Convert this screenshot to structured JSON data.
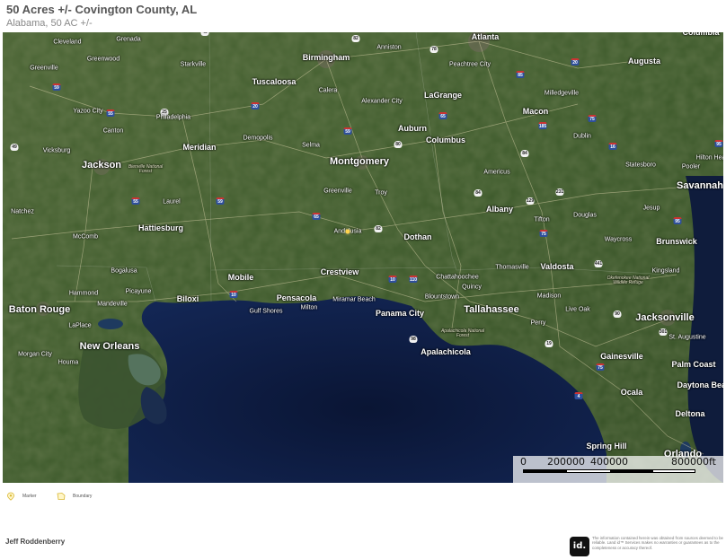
{
  "header": {
    "title": "50 Acres +/- Covington County, AL",
    "subtitle": "Alabama, 50 AC +/-"
  },
  "map": {
    "basemap": "satellite",
    "property_marker_city": "Andalusia",
    "cities": [
      {
        "name": "Cleveland",
        "size": "sm"
      },
      {
        "name": "Grenada",
        "size": "sm"
      },
      {
        "name": "Greenwood",
        "size": "sm"
      },
      {
        "name": "Greenville",
        "size": "sm"
      },
      {
        "name": "Starkville",
        "size": "sm"
      },
      {
        "name": "Birmingham",
        "size": "med"
      },
      {
        "name": "Anniston",
        "size": "sm"
      },
      {
        "name": "Atlanta",
        "size": "med"
      },
      {
        "name": "Peachtree City",
        "size": "sm"
      },
      {
        "name": "Augusta",
        "size": "med"
      },
      {
        "name": "Columbia",
        "size": "med"
      },
      {
        "name": "Tuscaloosa",
        "size": "med"
      },
      {
        "name": "Calera",
        "size": "sm"
      },
      {
        "name": "Alexander City",
        "size": "sm"
      },
      {
        "name": "LaGrange",
        "size": "med"
      },
      {
        "name": "Milledgeville",
        "size": "sm"
      },
      {
        "name": "Yazoo City",
        "size": "sm"
      },
      {
        "name": "Philadelphia",
        "size": "sm"
      },
      {
        "name": "Canton",
        "size": "sm"
      },
      {
        "name": "Demopolis",
        "size": "sm"
      },
      {
        "name": "Auburn",
        "size": "med"
      },
      {
        "name": "Macon",
        "size": "med"
      },
      {
        "name": "Dublin",
        "size": "sm"
      },
      {
        "name": "Vicksburg",
        "size": "sm"
      },
      {
        "name": "Meridian",
        "size": "med"
      },
      {
        "name": "Selma",
        "size": "sm"
      },
      {
        "name": "Columbus",
        "size": "med"
      },
      {
        "name": "Jackson",
        "size": "big"
      },
      {
        "name": "Montgomery",
        "size": "big"
      },
      {
        "name": "Americus",
        "size": "sm"
      },
      {
        "name": "Statesboro",
        "size": "sm"
      },
      {
        "name": "Pooler",
        "size": "sm"
      },
      {
        "name": "Hilton Head",
        "size": "sm"
      },
      {
        "name": "Greenville",
        "size": "sm"
      },
      {
        "name": "Troy",
        "size": "sm"
      },
      {
        "name": "Savannah",
        "size": "big"
      },
      {
        "name": "Natchez",
        "size": "sm"
      },
      {
        "name": "Laurel",
        "size": "sm"
      },
      {
        "name": "Albany",
        "size": "med"
      },
      {
        "name": "Jesup",
        "size": "sm"
      },
      {
        "name": "Tifton",
        "size": "sm"
      },
      {
        "name": "Douglas",
        "size": "sm"
      },
      {
        "name": "McComb",
        "size": "sm"
      },
      {
        "name": "Hattiesburg",
        "size": "med"
      },
      {
        "name": "Andalusia",
        "size": "sm"
      },
      {
        "name": "Dothan",
        "size": "med"
      },
      {
        "name": "Waycross",
        "size": "sm"
      },
      {
        "name": "Brunswick",
        "size": "med"
      },
      {
        "name": "Bogalusa",
        "size": "sm"
      },
      {
        "name": "Mobile",
        "size": "med"
      },
      {
        "name": "Crestview",
        "size": "med"
      },
      {
        "name": "Thomasville",
        "size": "sm"
      },
      {
        "name": "Valdosta",
        "size": "med"
      },
      {
        "name": "Kingsland",
        "size": "sm"
      },
      {
        "name": "Picayune",
        "size": "sm"
      },
      {
        "name": "Milton",
        "size": "sm"
      },
      {
        "name": "Chattahoochee",
        "size": "sm"
      },
      {
        "name": "Quincy",
        "size": "sm"
      },
      {
        "name": "Hammond",
        "size": "sm"
      },
      {
        "name": "Biloxi",
        "size": "med"
      },
      {
        "name": "Pensacola",
        "size": "med"
      },
      {
        "name": "Miramar Beach",
        "size": "sm"
      },
      {
        "name": "Blountstown",
        "size": "sm"
      },
      {
        "name": "Madison",
        "size": "sm"
      },
      {
        "name": "Mandeville",
        "size": "sm"
      },
      {
        "name": "Gulf Shores",
        "size": "sm"
      },
      {
        "name": "Panama City",
        "size": "med"
      },
      {
        "name": "Tallahassee",
        "size": "big"
      },
      {
        "name": "Live Oak",
        "size": "sm"
      },
      {
        "name": "Baton Rouge",
        "size": "big"
      },
      {
        "name": "Jacksonville",
        "size": "big"
      },
      {
        "name": "LaPlace",
        "size": "sm"
      },
      {
        "name": "Perry",
        "size": "sm"
      },
      {
        "name": "St. Augustine",
        "size": "sm"
      },
      {
        "name": "New Orleans",
        "size": "big"
      },
      {
        "name": "Apalachicola",
        "size": "med"
      },
      {
        "name": "Morgan City",
        "size": "sm"
      },
      {
        "name": "Houma",
        "size": "sm"
      },
      {
        "name": "Gainesville",
        "size": "med"
      },
      {
        "name": "Palm Coast",
        "size": "med"
      },
      {
        "name": "Daytona Beach",
        "size": "med"
      },
      {
        "name": "Ocala",
        "size": "med"
      },
      {
        "name": "Deltona",
        "size": "med"
      },
      {
        "name": "Spring Hill",
        "size": "med"
      },
      {
        "name": "Orlando",
        "size": "big"
      }
    ],
    "parks": [
      {
        "name": "Bienville National Forest"
      },
      {
        "name": "Apalachicola National Forest"
      },
      {
        "name": "Okefenokee National Wildlife Refuge"
      }
    ],
    "shields": [
      {
        "label": "45",
        "type": "us"
      },
      {
        "label": "82",
        "type": "us"
      },
      {
        "label": "78",
        "type": "us"
      },
      {
        "label": "59",
        "type": "i"
      },
      {
        "label": "20",
        "type": "i"
      },
      {
        "label": "85",
        "type": "i"
      },
      {
        "label": "25",
        "type": "us"
      },
      {
        "label": "20",
        "type": "i"
      },
      {
        "label": "55",
        "type": "i"
      },
      {
        "label": "59",
        "type": "i"
      },
      {
        "label": "65",
        "type": "i"
      },
      {
        "label": "185",
        "type": "i"
      },
      {
        "label": "75",
        "type": "i"
      },
      {
        "label": "16",
        "type": "i"
      },
      {
        "label": "80",
        "type": "us"
      },
      {
        "label": "95",
        "type": "i"
      },
      {
        "label": "49",
        "type": "us"
      },
      {
        "label": "84",
        "type": "us"
      },
      {
        "label": "59",
        "type": "i"
      },
      {
        "label": "55",
        "type": "i"
      },
      {
        "label": "65",
        "type": "i"
      },
      {
        "label": "82",
        "type": "us"
      },
      {
        "label": "84",
        "type": "us"
      },
      {
        "label": "231",
        "type": "us"
      },
      {
        "label": "129",
        "type": "us"
      },
      {
        "label": "10",
        "type": "i"
      },
      {
        "label": "110",
        "type": "i"
      },
      {
        "label": "75",
        "type": "i"
      },
      {
        "label": "441",
        "type": "us"
      },
      {
        "label": "95",
        "type": "i"
      },
      {
        "label": "98",
        "type": "us"
      },
      {
        "label": "19",
        "type": "us"
      },
      {
        "label": "10",
        "type": "i"
      },
      {
        "label": "75",
        "type": "i"
      },
      {
        "label": "4",
        "type": "i"
      },
      {
        "label": "90",
        "type": "us"
      },
      {
        "label": "301",
        "type": "us"
      }
    ]
  },
  "scalebar": {
    "ticks": [
      "0",
      "200000",
      "400000",
      "800000ft"
    ]
  },
  "legend": {
    "marker": "Marker",
    "boundary": "Boundary"
  },
  "footer": {
    "author": "Jeff Roddenberry",
    "logo": "id.",
    "disclaimer": "The information contained herein was obtained from sources deemed to be reliable. Land id™ Services makes no warranties or guarantees as to the completeness or accuracy thereof."
  },
  "colors": {
    "land": "#3f5a2c",
    "water": "#0f1c3c",
    "marker": "#ffd34d"
  }
}
